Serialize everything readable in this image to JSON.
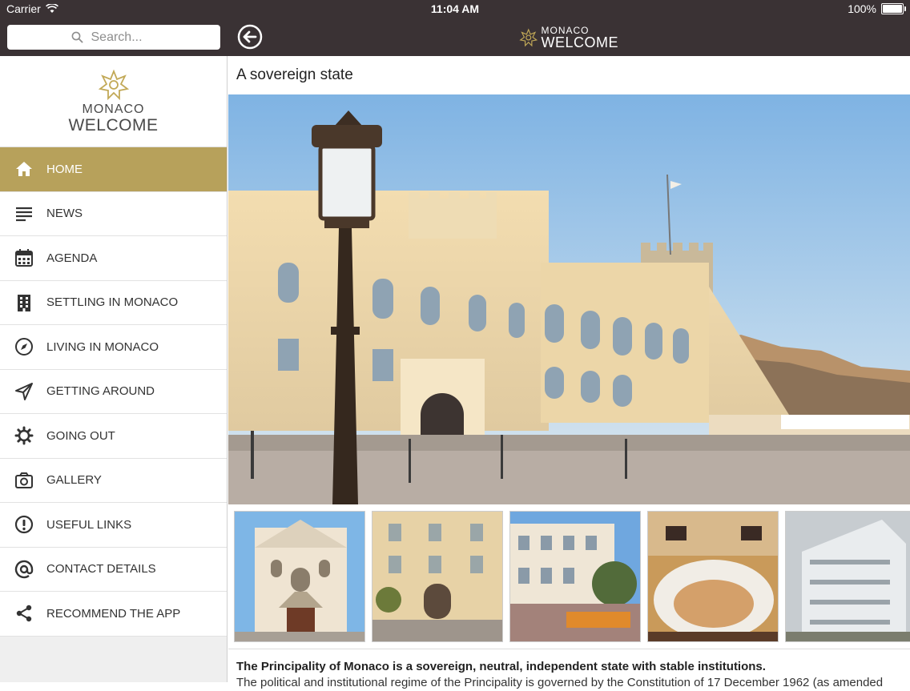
{
  "status": {
    "carrier": "Carrier",
    "time": "11:04 AM",
    "battery": "100%"
  },
  "search": {
    "placeholder": "Search..."
  },
  "brand": {
    "line1": "MONACO",
    "line2": "WELCOME"
  },
  "menu": [
    {
      "label": "HOME",
      "icon": "home-icon",
      "active": true
    },
    {
      "label": "NEWS",
      "icon": "news-icon"
    },
    {
      "label": "AGENDA",
      "icon": "calendar-icon"
    },
    {
      "label": "SETTLING IN MONACO",
      "icon": "building-icon"
    },
    {
      "label": "LIVING IN MONACO",
      "icon": "compass-icon"
    },
    {
      "label": "GETTING AROUND",
      "icon": "navigation-arrow-icon"
    },
    {
      "label": "GOING OUT",
      "icon": "gear-icon"
    },
    {
      "label": "GALLERY",
      "icon": "camera-icon"
    },
    {
      "label": "USEFUL LINKS",
      "icon": "exclamation-icon"
    },
    {
      "label": "CONTACT DETAILS",
      "icon": "at-sign-icon"
    },
    {
      "label": "RECOMMEND THE APP",
      "icon": "share-icon"
    }
  ],
  "main": {
    "title": "A sovereign state",
    "intro": "The Principality of Monaco is a sovereign, neutral, independent state with stable institutions.",
    "body": "The political and institutional regime of the Principality is governed by the Constitution of 17 December 1962 (as amended"
  },
  "colors": {
    "topbar": "#3a3234",
    "accent": "#b7a15b",
    "gold": "#c2a957"
  }
}
